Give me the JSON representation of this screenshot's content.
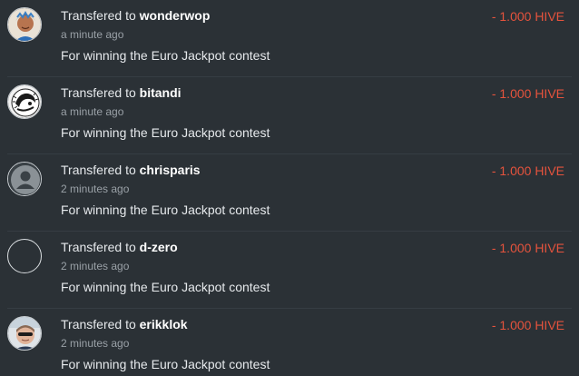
{
  "colors": {
    "background": "#2b3136",
    "amount_negative": "#e5533d",
    "text_primary": "#e6e9ec",
    "text_secondary": "#9aa1a7"
  },
  "transfers": [
    {
      "prefix": "Transfered to ",
      "user": "wonderwop",
      "time": "a minute ago",
      "memo": "For winning the Euro Jackpot contest",
      "amount": "- 1.000 HIVE",
      "avatar_icon": "wonderwop-avatar-icon"
    },
    {
      "prefix": "Transfered to ",
      "user": "bitandi",
      "time": "a minute ago",
      "memo": "For winning the Euro Jackpot contest",
      "amount": "- 1.000 HIVE",
      "avatar_icon": "bitandi-avatar-icon"
    },
    {
      "prefix": "Transfered to ",
      "user": "chrisparis",
      "time": "2 minutes ago",
      "memo": "For winning the Euro Jackpot contest",
      "amount": "- 1.000 HIVE",
      "avatar_icon": "default-user-avatar-icon"
    },
    {
      "prefix": "Transfered to ",
      "user": "d-zero",
      "time": "2 minutes ago",
      "memo": "For winning the Euro Jackpot contest",
      "amount": "- 1.000 HIVE",
      "avatar_icon": "empty-avatar-icon"
    },
    {
      "prefix": "Transfered to ",
      "user": "erikklok",
      "time": "2 minutes ago",
      "memo": "For winning the Euro Jackpot contest",
      "amount": "- 1.000 HIVE",
      "avatar_icon": "erikklok-avatar-icon"
    }
  ]
}
